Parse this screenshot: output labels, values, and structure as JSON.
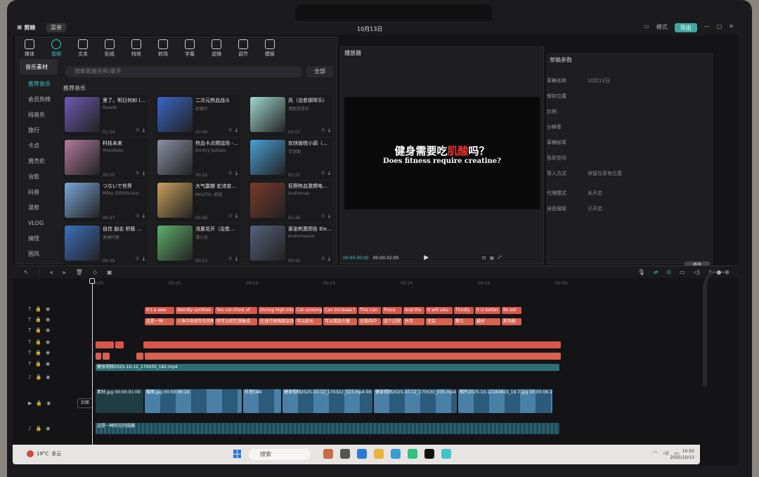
{
  "app": {
    "logo_text": "剪映",
    "menu_label": "菜单",
    "project_title": "10月13日"
  },
  "window_controls": {
    "layout_label": "模式",
    "export_label": "导出"
  },
  "toolbar": {
    "items": [
      {
        "label": "媒体",
        "icon": "media-icon"
      },
      {
        "label": "音频",
        "icon": "audio-icon"
      },
      {
        "label": "文本",
        "icon": "text-icon"
      },
      {
        "label": "贴纸",
        "icon": "sticker-icon"
      },
      {
        "label": "特效",
        "icon": "effects-icon"
      },
      {
        "label": "转场",
        "icon": "transition-icon"
      },
      {
        "label": "字幕",
        "icon": "subtitle-icon"
      },
      {
        "label": "滤镜",
        "icon": "filter-icon"
      },
      {
        "label": "调节",
        "icon": "adjust-icon"
      },
      {
        "label": "模板",
        "icon": "template-icon"
      }
    ],
    "active_index": 1
  },
  "sidebar": {
    "items": [
      "音乐素材",
      "推荐音乐",
      "会员热榜",
      "纯音乐",
      "旅行",
      "卡点",
      "周杰伦",
      "治愈",
      "抖音",
      "混剪",
      "VLOG",
      "搞怪",
      "国风"
    ]
  },
  "library": {
    "search_placeholder": "搜索歌曲名称/歌手",
    "filter_label": "全部",
    "section_title": "推荐音乐",
    "tracks": [
      {
        "name": "里了，明日何如 (Sped Up)",
        "artist": "RoseW",
        "duration": "01:54",
        "color": "#6a5bb0"
      },
      {
        "name": "二次元热血战斗",
        "artist": "初黄叶",
        "duration": "00:40",
        "color": "#3a66c6"
      },
      {
        "name": "风（治愈钢琴乐）",
        "artist": "清新轻音乐",
        "duration": "02:57",
        "color": "#9fd8d0"
      },
      {
        "name": "科技未来",
        "artist": "Yooodedu",
        "duration": "00:55",
        "color": "#b07a9a"
      },
      {
        "name": "热血卡点燃战场 - Born To Fight A...",
        "artist": "Dmitry ballaso",
        "duration": "00:52",
        "color": "#8a8fa6"
      },
      {
        "name": "欢快愉悦小调（抖音乐）",
        "artist": "芋泥图",
        "duration": "01:27",
        "color": "#4a9fd6"
      },
      {
        "name": "つないで世界",
        "artist": "Milky Gift/Minano",
        "duration": "00:47",
        "color": "#7aa6d8"
      },
      {
        "name": "大气震撼 史诗宣传片",
        "artist": "MOUTH, 妮姐",
        "duration": "00:06",
        "color": "#c9a05a"
      },
      {
        "name": "狂野热血激燃电子 I Will Tear You Ap...",
        "artist": "Audiomap",
        "duration": "01:46",
        "color": "#7a3a2a"
      },
      {
        "name": "自信 励志 积极 学创 动感",
        "artist": "淋淋阿紫",
        "duration": "00:39",
        "color": "#3c6fbf"
      },
      {
        "name": "浅夏花开（治愈钢琴乐）",
        "artist": "清小乐",
        "duration": "00:53",
        "color": "#5fae6a"
      },
      {
        "name": "紧张刺激预告 Elegant Trailerv",
        "artist": "Audiomware",
        "duration": "00:42",
        "color": "#55607a"
      }
    ]
  },
  "player": {
    "title": "播放器",
    "subtitle_cn_a": "健身需要吃",
    "subtitle_cn_red": "肌酸",
    "subtitle_cn_b": "吗？",
    "subtitle_en": "Does fitness require creatine?",
    "time_current": "00:00:00:00",
    "time_total": "00:00:32:00"
  },
  "properties": {
    "title": "草稿参数",
    "rows": [
      {
        "label": "草稿名称",
        "value": "10月13日"
      },
      {
        "label": "保存位置",
        "value": ""
      },
      {
        "label": "比例",
        "value": ""
      },
      {
        "label": "分辨率",
        "value": ""
      },
      {
        "label": "草稿帧率",
        "value": ""
      },
      {
        "label": "色彩空间",
        "value": ""
      },
      {
        "label": "导入方式",
        "value": "保留在原有位置"
      },
      {
        "label": "代理模式",
        "value": "未开启"
      },
      {
        "label": "自由层级",
        "value": "已开启"
      }
    ],
    "confirm_label": "修改"
  },
  "timeline": {
    "ruler": [
      "00:00",
      "00:05",
      "00:10",
      "00:15",
      "00:20",
      "00:25",
      "00:30"
    ],
    "cover_label": "封面",
    "text_row1": [
      "It's a wee",
      "Weirdly synthes",
      "You can think of",
      "During high-inte",
      "Can prolong",
      "Can increase t",
      "This can",
      "Proce",
      "And the",
      "It will also",
      "Thirdly",
      "it is better",
      "Its ext"
    ],
    "text_row2": [
      "这是一种",
      "人体中自然存在的物质",
      "你可以把它想象成",
      "在进行高强度运动时",
      "可以延长",
      "可以增加力量",
      "在肌肉中",
      "这个过程",
      "并且",
      "还会",
      "第三",
      "最好",
      "其功能"
    ],
    "audio_label": "健身视频2025-10-12_170030_182.mp4",
    "audio_duration": "00:00:22:00",
    "video_clips": [
      {
        "label": "素材.jpg",
        "duration": "00:00:01:09"
      },
      {
        "label": "截图.jpg",
        "duration": "00:00:06:24"
      },
      {
        "label": "抖音EAN",
        "duration": ""
      },
      {
        "label": "健身视频2025-10-12_170322_023.mp4",
        "duration": "00:00:05:02"
      },
      {
        "label": "健身视频2025-10-12_170530_035.mp4",
        "duration": "00:0"
      },
      {
        "label": "图片2025-10-12164815_19.7.jpg",
        "duration": "00:00:06:24"
      }
    ],
    "music_label": "这是一种存在的肌酸"
  },
  "taskbar": {
    "weather": "19°C",
    "weather_sub": "多云",
    "search_label": "搜索",
    "time": "10:50",
    "date": "2025/10/13"
  }
}
